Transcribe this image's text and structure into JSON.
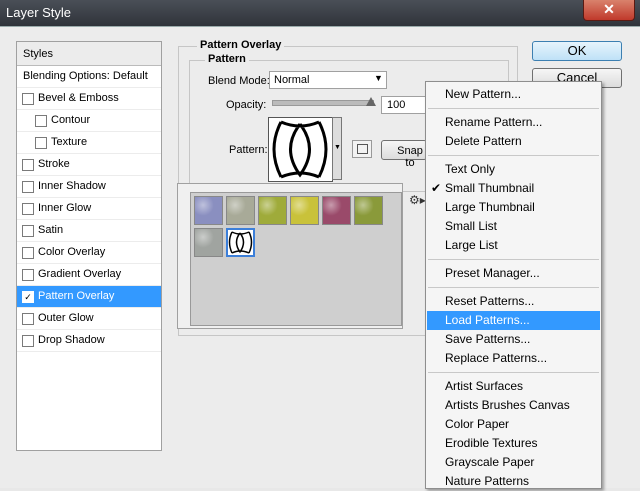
{
  "window": {
    "title": "Layer Style",
    "close_label": "✕"
  },
  "styles_panel": {
    "header": "Styles",
    "items": [
      {
        "label": "Blending Options: Default",
        "checkbox": false
      },
      {
        "label": "Bevel & Emboss",
        "checkbox": true,
        "checked": false
      },
      {
        "label": "Contour",
        "checkbox": true,
        "checked": false,
        "indent": true
      },
      {
        "label": "Texture",
        "checkbox": true,
        "checked": false,
        "indent": true
      },
      {
        "label": "Stroke",
        "checkbox": true,
        "checked": false
      },
      {
        "label": "Inner Shadow",
        "checkbox": true,
        "checked": false
      },
      {
        "label": "Inner Glow",
        "checkbox": true,
        "checked": false
      },
      {
        "label": "Satin",
        "checkbox": true,
        "checked": false
      },
      {
        "label": "Color Overlay",
        "checkbox": true,
        "checked": false
      },
      {
        "label": "Gradient Overlay",
        "checkbox": true,
        "checked": false
      },
      {
        "label": "Pattern Overlay",
        "checkbox": true,
        "checked": true,
        "selected": true
      },
      {
        "label": "Outer Glow",
        "checkbox": true,
        "checked": false
      },
      {
        "label": "Drop Shadow",
        "checkbox": true,
        "checked": false
      }
    ]
  },
  "pattern_overlay": {
    "section_title": "Pattern Overlay",
    "group_title": "Pattern",
    "blend_mode_label": "Blend Mode:",
    "blend_mode_value": "Normal",
    "opacity_label": "Opacity:",
    "opacity_value": "100",
    "opacity_level": 1.0,
    "pattern_label": "Pattern:",
    "snap_label": "Snap to"
  },
  "buttons": {
    "ok": "OK",
    "cancel": "Cancel"
  },
  "pattern_picker": {
    "tiles": [
      {
        "color": "#8a8fc0"
      },
      {
        "color": "#a8aa98"
      },
      {
        "color": "#9fab3a"
      },
      {
        "color": "#c9c23a"
      },
      {
        "color": "#9a4a6a"
      },
      {
        "color": "#8a9a3a"
      },
      {
        "color": "#a0a4a0"
      },
      {
        "color": "#ffffff",
        "selected": true
      }
    ]
  },
  "menu": {
    "groups": [
      [
        "New Pattern..."
      ],
      [
        "Rename Pattern...",
        "Delete Pattern"
      ],
      [
        "Text Only",
        "Small Thumbnail",
        "Large Thumbnail",
        "Small List",
        "Large List"
      ],
      [
        "Preset Manager..."
      ],
      [
        "Reset Patterns...",
        "Load Patterns...",
        "Save Patterns...",
        "Replace Patterns..."
      ],
      [
        "Artist Surfaces",
        "Artists Brushes Canvas",
        "Color Paper",
        "Erodible Textures",
        "Grayscale Paper",
        "Nature Patterns"
      ]
    ],
    "checked_item": "Small Thumbnail",
    "highlighted_item": "Load Patterns...",
    "accent_color": "#3399ff"
  }
}
